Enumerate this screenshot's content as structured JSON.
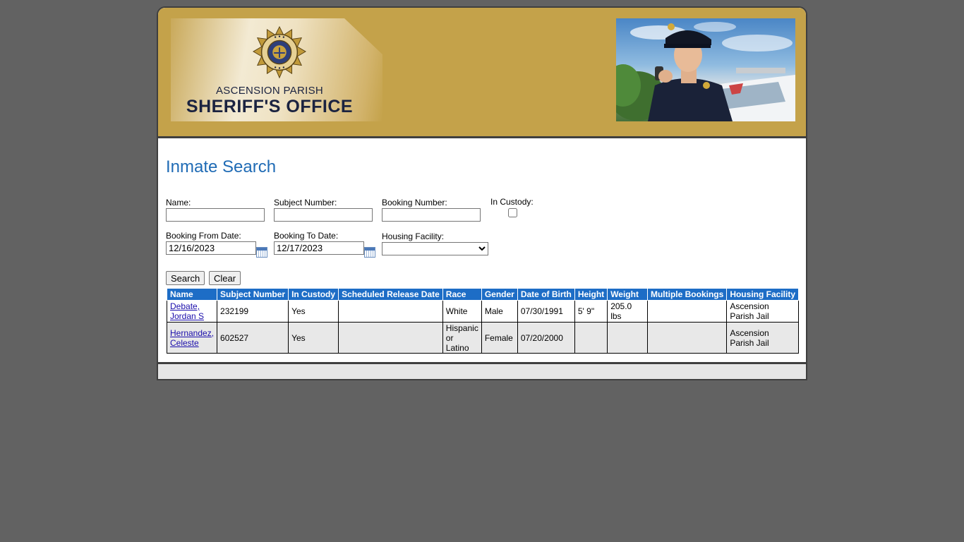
{
  "header": {
    "org_sub": "ASCENSION PARISH",
    "org_main": "SHERIFF'S OFFICE",
    "seal": {
      "top_text": "200th ANNIVERSARY",
      "bottom_text": "LOUISIANA",
      "years": [
        "1807",
        "2007"
      ]
    }
  },
  "page_title": "Inmate Search",
  "form": {
    "name_label": "Name:",
    "name_value": "",
    "subject_label": "Subject Number:",
    "subject_value": "",
    "booking_label": "Booking Number:",
    "booking_value": "",
    "custody_label": "In Custody:",
    "custody_checked": false,
    "from_label": "Booking From Date:",
    "from_value": "12/16/2023",
    "to_label": "Booking To Date:",
    "to_value": "12/17/2023",
    "housing_label": "Housing Facility:",
    "housing_value": "",
    "search_label": "Search",
    "clear_label": "Clear"
  },
  "table": {
    "headers": [
      "Name",
      "Subject Number",
      "In Custody",
      "Scheduled Release Date",
      "Race",
      "Gender",
      "Date of Birth",
      "Height",
      "Weight",
      "Multiple Bookings",
      "Housing Facility"
    ],
    "rows": [
      {
        "name_line1": "Debate,",
        "name_line2": "Jordan S",
        "subject": "232199",
        "custody": "Yes",
        "release": "",
        "race": "White",
        "gender": "Male",
        "dob": "07/30/1991",
        "height": "5' 9\"",
        "weight": "205.0 lbs",
        "multiple": "",
        "facility_line1": "Ascension",
        "facility_line2": "Parish Jail"
      },
      {
        "name_line1": "Hernandez,",
        "name_line2": "Celeste",
        "subject": "602527",
        "custody": "Yes",
        "release": "",
        "race_line1": "Hispanic",
        "race_line2": "or",
        "race_line3": "Latino",
        "gender": "Female",
        "dob": "07/20/2000",
        "height": "",
        "weight": "",
        "multiple": "",
        "facility_line1": "Ascension",
        "facility_line2": "Parish Jail"
      }
    ]
  },
  "colors": {
    "header_gold": "#c4a24a",
    "title_blue": "#1f6bb5",
    "table_header_blue": "#1d6dc6",
    "page_background": "#626262"
  }
}
